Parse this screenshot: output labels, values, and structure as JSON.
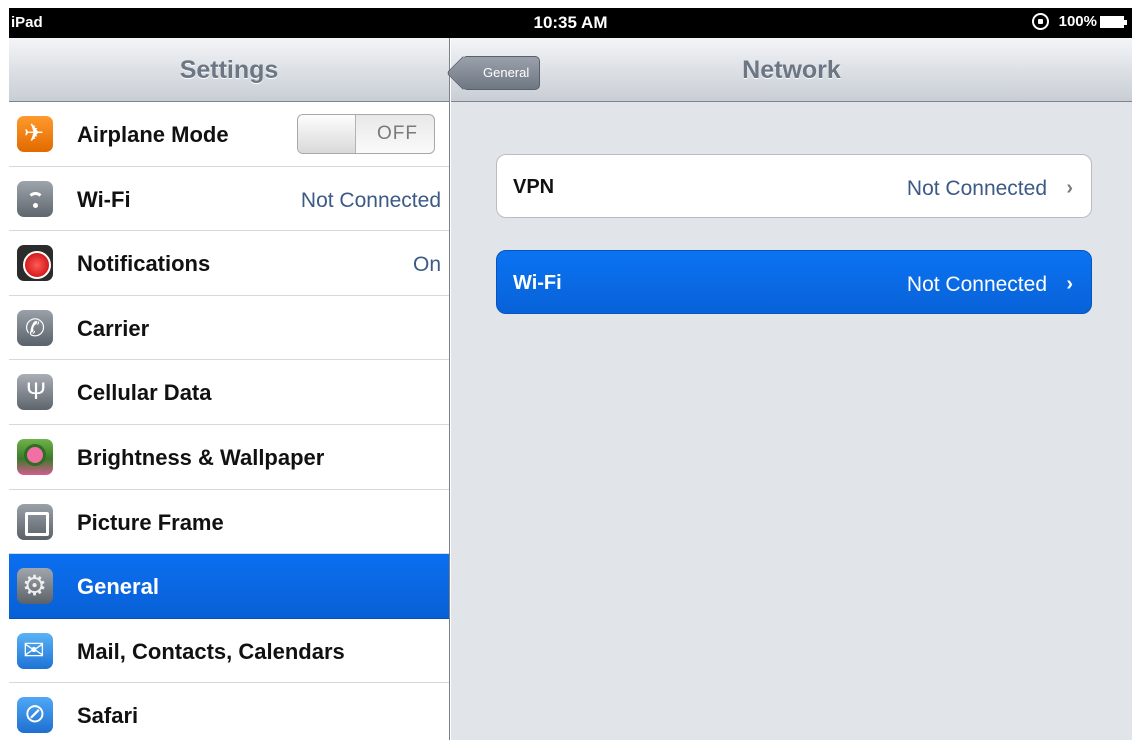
{
  "statusbar": {
    "carrier": "iPad",
    "time": "10:35 AM",
    "battery": "100%"
  },
  "master": {
    "title": "Settings",
    "items": [
      {
        "label": "Airplane Mode",
        "icon": "airplane-icon",
        "toggle": "OFF"
      },
      {
        "label": "Wi-Fi",
        "icon": "wifi-icon",
        "value": "Not Connected"
      },
      {
        "label": "Notifications",
        "icon": "notifications-icon",
        "value": "On"
      },
      {
        "label": "Carrier",
        "icon": "carrier-icon"
      },
      {
        "label": "Cellular Data",
        "icon": "cellular-data-icon"
      },
      {
        "label": "Brightness & Wallpaper",
        "icon": "brightness-wallpaper-icon"
      },
      {
        "label": "Picture Frame",
        "icon": "picture-frame-icon"
      },
      {
        "label": "General",
        "icon": "general-icon",
        "selected": true
      },
      {
        "label": "Mail, Contacts, Calendars",
        "icon": "mail-icon"
      },
      {
        "label": "Safari",
        "icon": "safari-icon"
      }
    ]
  },
  "detail": {
    "back_label": "General",
    "title": "Network",
    "cells": [
      {
        "label": "VPN",
        "value": "Not Connected"
      },
      {
        "label": "Wi-Fi",
        "value": "Not Connected",
        "selected": true
      }
    ]
  },
  "colors": {
    "selection": "#0a6ae6",
    "value_text": "#3b5a85",
    "nav_title": "#6d7784"
  }
}
